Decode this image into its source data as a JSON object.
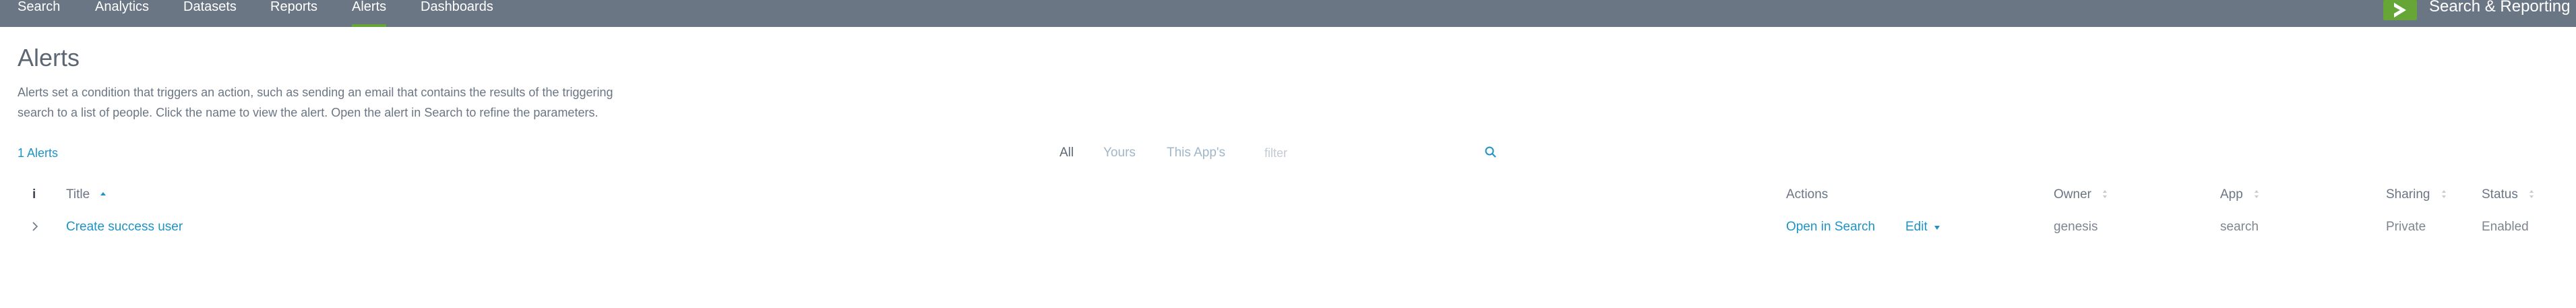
{
  "nav": {
    "items": [
      "Search",
      "Analytics",
      "Datasets",
      "Reports",
      "Alerts",
      "Dashboards"
    ],
    "active": "Alerts"
  },
  "app": {
    "title": "Search & Reporting",
    "logo_icon": "app-logo-icon",
    "accent_color": "#65a637"
  },
  "page": {
    "title": "Alerts",
    "description_line1": "Alerts set a condition that triggers an action, such as sending an email that contains the results of the triggering",
    "description_line2": "search to a list of people. Click the name to view the alert. Open the alert in Search to refine the parameters.",
    "count": "1 Alerts"
  },
  "filters": {
    "tabs": [
      "All",
      "Yours",
      "This App's"
    ],
    "selected": "All",
    "placeholder": "filter",
    "value": ""
  },
  "table": {
    "columns": {
      "info": "i",
      "title": "Title",
      "actions": "Actions",
      "owner": "Owner",
      "app": "App",
      "sharing": "Sharing",
      "status": "Status"
    },
    "rows": [
      {
        "title": "Create success user",
        "open_action": "Open in Search",
        "edit_action": "Edit",
        "owner": "genesis",
        "app": "search",
        "sharing": "Private",
        "status": "Enabled"
      }
    ]
  },
  "colors": {
    "topbar": "#6b7684",
    "link": "#1e93c6",
    "active_tab_underline": "#65a637"
  }
}
